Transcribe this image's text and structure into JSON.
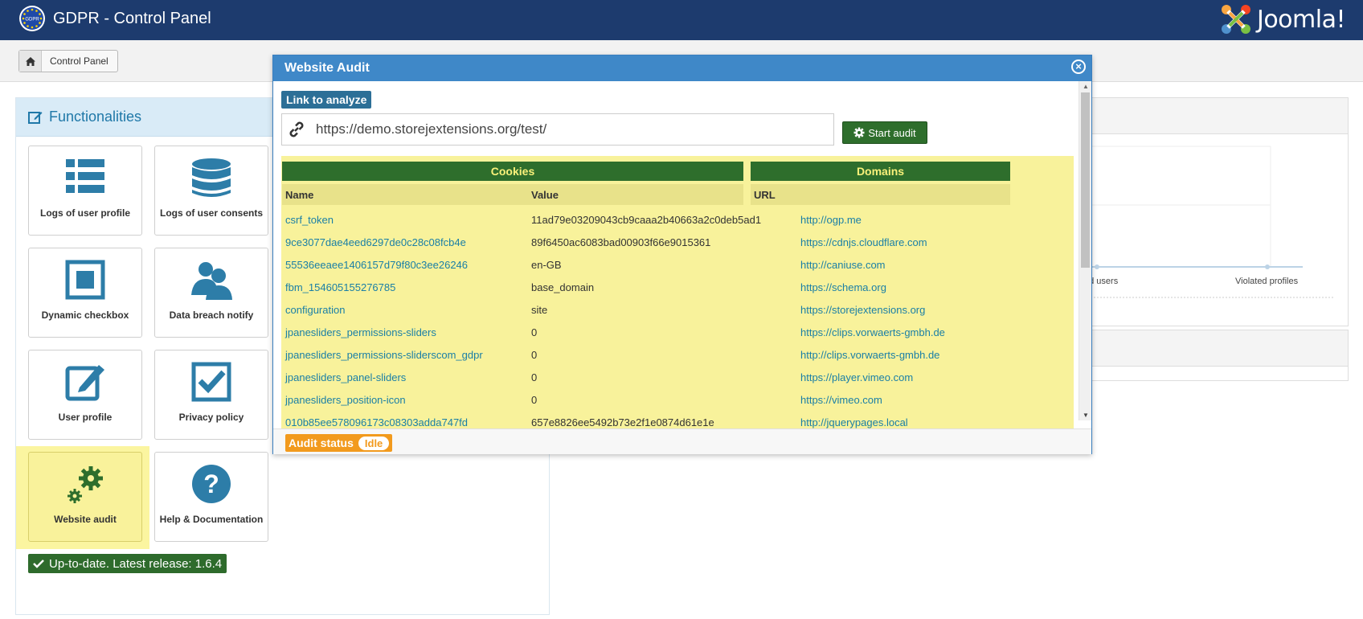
{
  "header": {
    "title": "GDPR - Control Panel",
    "eu_logo_text": "GDPR",
    "joomla_text": "Joomla!"
  },
  "toolbar": {
    "breadcrumb": "Control Panel"
  },
  "functionalities": {
    "title": "Functionalities",
    "tiles": [
      {
        "label": "Logs of user profile",
        "icon": "list-icon"
      },
      {
        "label": "Logs of user consents",
        "icon": "database-icon"
      },
      {
        "label": "Dynamic checkbox",
        "icon": "checkbox-square-icon"
      },
      {
        "label": "Data breach notify",
        "icon": "users-icon"
      },
      {
        "label": "User profile",
        "icon": "edit-icon"
      },
      {
        "label": "Privacy policy",
        "icon": "check-icon"
      },
      {
        "label": "Website audit",
        "icon": "gears-icon"
      },
      {
        "label": "Help & Documentation",
        "icon": "question-icon"
      }
    ],
    "status": "Up-to-date. Latest release: 1.6.4"
  },
  "background_chart": {
    "labels": [
      "ed users",
      "Violated profiles"
    ]
  },
  "modal": {
    "title": "Website Audit",
    "link_label": "Link to analyze",
    "url_value": "https://demo.storejextensions.org/test/",
    "start_button": "Start audit",
    "cookies_title": "Cookies",
    "domains_title": "Domains",
    "col_name": "Name",
    "col_value": "Value",
    "col_url": "URL",
    "cookies": [
      {
        "name": "csrf_token",
        "value": "11ad79e03209043cb9caaa2b40663a2c0deb5ad1"
      },
      {
        "name": "9ce3077dae4eed6297de0c28c08fcb4e",
        "value": "89f6450ac6083bad00903f66e9015361"
      },
      {
        "name": "55536eeaee1406157d79f80c3ee26246",
        "value": "en-GB"
      },
      {
        "name": "fbm_154605155276785",
        "value": "base_domain"
      },
      {
        "name": "configuration",
        "value": "site"
      },
      {
        "name": "jpanesliders_permissions-sliders",
        "value": "0"
      },
      {
        "name": "jpanesliders_permissions-sliderscom_gdpr",
        "value": "0"
      },
      {
        "name": "jpanesliders_panel-sliders",
        "value": "0"
      },
      {
        "name": "jpanesliders_position-icon",
        "value": "0"
      },
      {
        "name": "010b85ee578096173c08303adda747fd",
        "value": "657e8826ee5492b73e2f1e0874d61e1e"
      }
    ],
    "domains": [
      "http://ogp.me",
      "https://cdnjs.cloudflare.com",
      "http://caniuse.com",
      "https://schema.org",
      "https://storejextensions.org",
      "https://clips.vorwaerts-gmbh.de",
      "http://clips.vorwaerts-gmbh.de",
      "https://player.vimeo.com",
      "https://vimeo.com",
      "http://jquerypages.local"
    ],
    "audit_status_label": "Audit status",
    "audit_status_value": "Idle"
  },
  "colors": {
    "header": "#1d3b6e",
    "accent_green": "#2e6e2c",
    "table_bg": "#f8f29b",
    "status_orange": "#f29a1d",
    "link_blue": "#1a7fa6"
  }
}
